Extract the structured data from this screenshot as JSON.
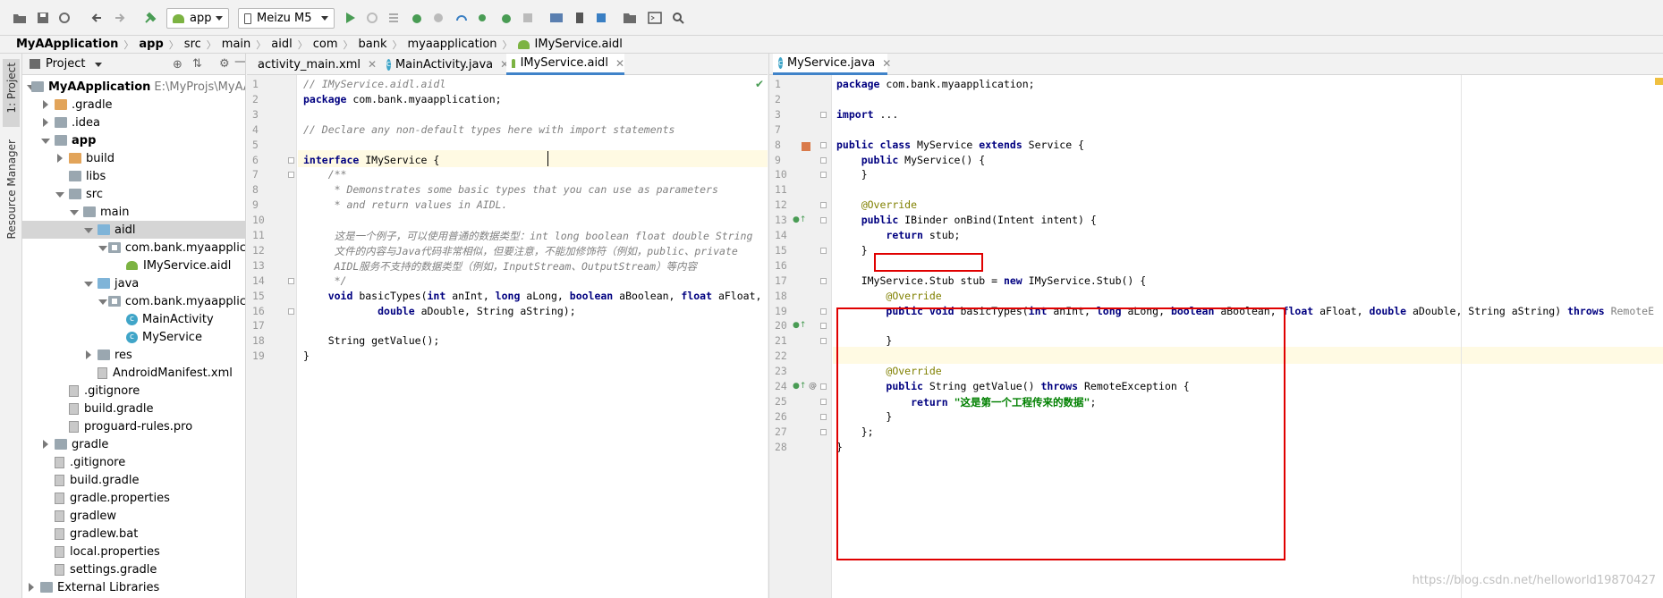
{
  "toolbar": {
    "config_label": "app",
    "device_label": "Meizu M5"
  },
  "breadcrumb": [
    "MyAApplication",
    "app",
    "src",
    "main",
    "aidl",
    "com",
    "bank",
    "myaapplication",
    "IMyService.aidl"
  ],
  "side_strip": {
    "project_tab": "1: Project",
    "resource_manager": "Resource Manager"
  },
  "project_panel": {
    "view_label": "Project",
    "tree": [
      {
        "label": "MyAApplication",
        "path": "E:\\MyProjs\\MyAA",
        "depth": 0,
        "state": "open",
        "icon": "module-folder-icon"
      },
      {
        "label": ".gradle",
        "depth": 1,
        "state": "closed",
        "icon": "folder-orange-icon"
      },
      {
        "label": ".idea",
        "depth": 1,
        "state": "closed",
        "icon": "folder-icon"
      },
      {
        "label": "app",
        "depth": 1,
        "state": "open",
        "icon": "module-folder-icon"
      },
      {
        "label": "build",
        "depth": 2,
        "state": "closed",
        "icon": "folder-orange-icon"
      },
      {
        "label": "libs",
        "depth": 2,
        "state": "none",
        "icon": "folder-icon"
      },
      {
        "label": "src",
        "depth": 2,
        "state": "open",
        "icon": "folder-icon"
      },
      {
        "label": "main",
        "depth": 3,
        "state": "open",
        "icon": "folder-icon"
      },
      {
        "label": "aidl",
        "depth": 4,
        "state": "open",
        "icon": "folder-blue-icon"
      },
      {
        "label": "com.bank.myaapplic",
        "depth": 5,
        "state": "open",
        "icon": "package-icon"
      },
      {
        "label": "IMyService.aidl",
        "depth": 6,
        "state": "none",
        "icon": "android-icon"
      },
      {
        "label": "java",
        "depth": 4,
        "state": "open",
        "icon": "folder-blue-icon"
      },
      {
        "label": "com.bank.myaapplic",
        "depth": 5,
        "state": "open",
        "icon": "package-icon"
      },
      {
        "label": "MainActivity",
        "depth": 6,
        "state": "none",
        "icon": "class-icon"
      },
      {
        "label": "MyService",
        "depth": 6,
        "state": "none",
        "icon": "class-icon"
      },
      {
        "label": "res",
        "depth": 4,
        "state": "closed",
        "icon": "folder-icon"
      },
      {
        "label": "AndroidManifest.xml",
        "depth": 4,
        "state": "none",
        "icon": "manifest-icon"
      },
      {
        "label": ".gitignore",
        "depth": 2,
        "state": "none",
        "icon": "file-icon"
      },
      {
        "label": "build.gradle",
        "depth": 2,
        "state": "none",
        "icon": "gradle-icon"
      },
      {
        "label": "proguard-rules.pro",
        "depth": 2,
        "state": "none",
        "icon": "file-icon"
      },
      {
        "label": "gradle",
        "depth": 1,
        "state": "closed",
        "icon": "folder-icon"
      },
      {
        "label": ".gitignore",
        "depth": 1,
        "state": "none",
        "icon": "file-icon"
      },
      {
        "label": "build.gradle",
        "depth": 1,
        "state": "none",
        "icon": "gradle-icon"
      },
      {
        "label": "gradle.properties",
        "depth": 1,
        "state": "none",
        "icon": "file-icon"
      },
      {
        "label": "gradlew",
        "depth": 1,
        "state": "none",
        "icon": "file-icon"
      },
      {
        "label": "gradlew.bat",
        "depth": 1,
        "state": "none",
        "icon": "file-icon"
      },
      {
        "label": "local.properties",
        "depth": 1,
        "state": "none",
        "icon": "file-icon"
      },
      {
        "label": "settings.gradle",
        "depth": 1,
        "state": "none",
        "icon": "gradle-icon"
      },
      {
        "label": "External Libraries",
        "depth": 0,
        "state": "closed",
        "icon": "library-icon"
      }
    ]
  },
  "left_editor": {
    "tabs": [
      {
        "label": "activity_main.xml",
        "active": false
      },
      {
        "label": "MainActivity.java",
        "active": false
      },
      {
        "label": "IMyService.aidl",
        "active": true
      }
    ],
    "lines": [
      {
        "n": "1",
        "text": "// IMyService.aidl.aidl",
        "style": "cm"
      },
      {
        "n": "2",
        "text": "package com.bank.myaapplication;",
        "style": "pkg"
      },
      {
        "n": "3",
        "text": "",
        "style": "plain"
      },
      {
        "n": "4",
        "text": "// Declare any non-default types here with import statements",
        "style": "cm"
      },
      {
        "n": "5",
        "text": "",
        "style": "plain"
      },
      {
        "n": "6",
        "text": "interface IMyService {",
        "style": "iface"
      },
      {
        "n": "7",
        "text": "    /**",
        "style": "cm"
      },
      {
        "n": "8",
        "text": "     * Demonstrates some basic types that you can use as parameters",
        "style": "cm"
      },
      {
        "n": "9",
        "text": "     * and return values in AIDL.",
        "style": "cm"
      },
      {
        "n": "10",
        "text": "",
        "style": "plain"
      },
      {
        "n": "11",
        "text": "     这是一个例子，可以使用普通的数据类型：int long boolean float double String",
        "style": "cm"
      },
      {
        "n": "12",
        "text": "     文件的内容与Java代码非常相似，但要注意，不能加修饰符（例如，public、private",
        "style": "cm"
      },
      {
        "n": "13",
        "text": "     AIDL服务不支持的数据类型（例如，InputStream、OutputStream）等内容",
        "style": "cm"
      },
      {
        "n": "14",
        "text": "     */",
        "style": "cm"
      },
      {
        "n": "15",
        "text": "    void basicTypes(int anInt, long aLong, boolean aBoolean, float aFloat,",
        "style": "sig"
      },
      {
        "n": "16",
        "text": "            double aDouble, String aString);",
        "style": "sig2"
      },
      {
        "n": "17",
        "text": "",
        "style": "plain"
      },
      {
        "n": "18",
        "text": "    String getValue();",
        "style": "plain"
      },
      {
        "n": "19",
        "text": "}",
        "style": "plain"
      }
    ]
  },
  "right_editor": {
    "tabs": [
      {
        "label": "MyService.java",
        "active": true
      }
    ],
    "lines": [
      {
        "n": "1",
        "text": "package com.bank.myaapplication;"
      },
      {
        "n": "2",
        "text": ""
      },
      {
        "n": "3",
        "text": "import ..."
      },
      {
        "n": "7",
        "text": ""
      },
      {
        "n": "8",
        "text": "public class MyService extends Service {"
      },
      {
        "n": "9",
        "text": "    public MyService() {"
      },
      {
        "n": "10",
        "text": "    }"
      },
      {
        "n": "11",
        "text": ""
      },
      {
        "n": "12",
        "text": "    @Override"
      },
      {
        "n": "13",
        "text": "    public IBinder onBind(Intent intent) {"
      },
      {
        "n": "14",
        "text": "        return stub;"
      },
      {
        "n": "15",
        "text": "    }"
      },
      {
        "n": "16",
        "text": ""
      },
      {
        "n": "17",
        "text": "    IMyService.Stub stub = new IMyService.Stub() {"
      },
      {
        "n": "18",
        "text": "        @Override"
      },
      {
        "n": "19",
        "text": "        public void basicTypes(int anInt, long aLong, boolean aBoolean, float aFloat, double aDouble, String aString) throws RemoteE"
      },
      {
        "n": "20",
        "text": ""
      },
      {
        "n": "21",
        "text": "        }"
      },
      {
        "n": "22",
        "text": ""
      },
      {
        "n": "23",
        "text": "        @Override"
      },
      {
        "n": "24",
        "text": "        public String getValue() throws RemoteException {"
      },
      {
        "n": "25",
        "text": "            return \"这是第一个工程传来的数据\";"
      },
      {
        "n": "26",
        "text": "        }"
      },
      {
        "n": "27",
        "text": "    };"
      },
      {
        "n": "28",
        "text": "}"
      }
    ]
  },
  "watermark": "https://blog.csdn.net/helloworld19870427",
  "colors": {
    "highlight_box": "#e00000",
    "active_tab_underline": "#4083c9",
    "keyword": "#000080",
    "annotation": "#808000",
    "string": "#008000",
    "comment": "#808080",
    "current_line": "#fffae3"
  }
}
